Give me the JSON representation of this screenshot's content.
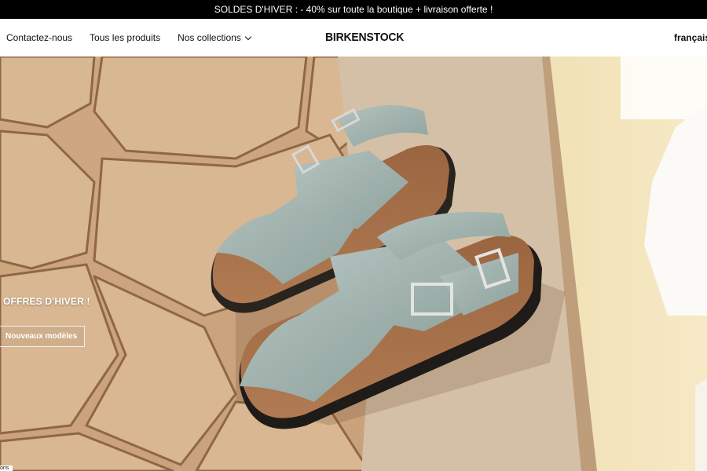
{
  "announcement": {
    "text": "SOLDES D'HIVER : - 40% sur toute la boutique + livraison offerte !"
  },
  "nav": {
    "links": [
      "Contactez-nous",
      "Tous les produits",
      "Nos collections"
    ],
    "brand": "BIRKENSTOCK",
    "language": "français"
  },
  "hero": {
    "headline": "OFFRES D'HIVER !",
    "cta": "Nouveaux modèles",
    "corner_text": "ons"
  },
  "colors": {
    "announcement_bg": "#000000",
    "sandal_suede": "#9fb1ad",
    "cork_footbed": "#a06c45",
    "stone": "#d7b996",
    "wall_yellow": "#f0dfb0"
  }
}
